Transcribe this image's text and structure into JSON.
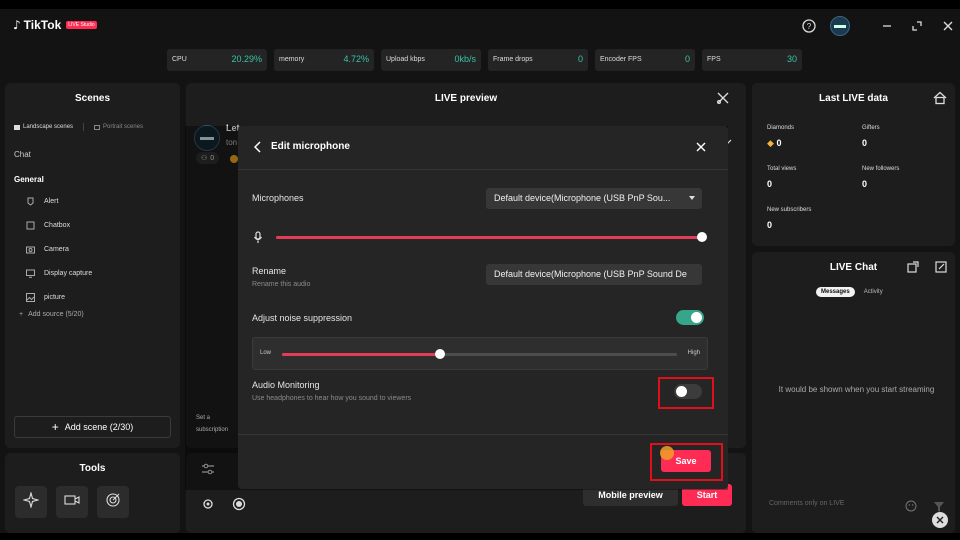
{
  "app": {
    "logo_text": "TikTok",
    "logo_badge": "LIVE Studio"
  },
  "stats": [
    {
      "label": "CPU",
      "value": "20.29%"
    },
    {
      "label": "memory",
      "value": "4.72%"
    },
    {
      "label": "Upload kbps",
      "value": "0kb/s"
    },
    {
      "label": "Frame drops",
      "value": "0"
    },
    {
      "label": "Encoder FPS",
      "value": "0"
    },
    {
      "label": "FPS",
      "value": "30"
    }
  ],
  "scenes": {
    "title": "Scenes",
    "tab_landscape": "Landscape scenes",
    "tab_portrait": "Portrait scenes",
    "group_chat": "Chat",
    "group_general": "General",
    "sources": [
      {
        "label": "Alert",
        "icon": "alert-icon"
      },
      {
        "label": "Chatbox",
        "icon": "chatbox-icon"
      },
      {
        "label": "Camera",
        "icon": "camera-icon"
      },
      {
        "label": "Display capture",
        "icon": "display-icon"
      },
      {
        "label": "picture",
        "icon": "picture-icon"
      }
    ],
    "add_source": "Add source (5/20)",
    "add_scene": "Add scene (2/30)"
  },
  "tools": {
    "title": "Tools"
  },
  "preview": {
    "title": "LIVE preview",
    "profile_name": "Let",
    "profile_sub": "ton",
    "viewer_count": "0",
    "subs_prompt_line1": "Set a",
    "subs_prompt_line2": "subscription"
  },
  "controls": {
    "mobile_preview": "Mobile preview",
    "start": "Start"
  },
  "last_live": {
    "title": "Last LIVE data",
    "diamonds_label": "Diamonds",
    "diamonds_value": "0",
    "gifters_label": "Gifters",
    "gifters_value": "0",
    "total_views_label": "Total views",
    "total_views_value": "0",
    "new_followers_label": "New followers",
    "new_followers_value": "0",
    "new_subscribers_label": "New subscribers",
    "new_subscribers_value": "0"
  },
  "live_chat": {
    "title": "LIVE Chat",
    "tab_messages": "Messages",
    "tab_activity": "Activity",
    "empty_text": "It would be shown when you start streaming",
    "comment_placeholder": "Comments only on LIVE"
  },
  "modal": {
    "title": "Edit microphone",
    "microphones_label": "Microphones",
    "microphone_selected": "Default device(Microphone (USB PnP Sou...",
    "volume_level": 1.0,
    "rename_label": "Rename",
    "rename_sublabel": "Rename this audio",
    "rename_value": "Default device(Microphone (USB PnP Sound De",
    "noise_label": "Adjust noise suppression",
    "noise_enabled": true,
    "noise_low": "Low",
    "noise_high": "High",
    "noise_level": 0.4,
    "monitoring_label": "Audio Monitoring",
    "monitoring_sublabel": "Use headphones to hear how you sound to viewers",
    "monitoring_enabled": false,
    "save_label": "Save"
  },
  "colors": {
    "accent": "#fe2c55",
    "toggle_on": "#36a58a",
    "stat_value": "#36c4a6",
    "highlight": "#e0101a"
  }
}
